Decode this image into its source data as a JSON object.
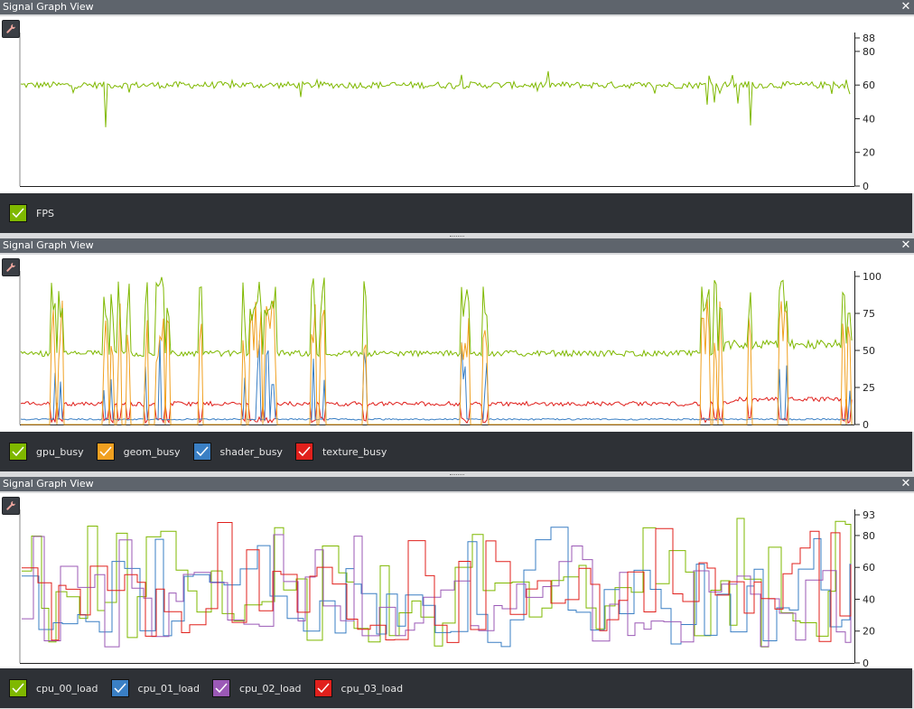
{
  "close_glyph": "✕",
  "panels": [
    {
      "title": "Signal Graph View",
      "y_ticks": [
        0,
        20,
        40,
        60,
        80,
        88
      ],
      "y_range": [
        0,
        88
      ],
      "legend": [
        {
          "label": "FPS",
          "color": "#7fb800"
        }
      ]
    },
    {
      "title": "Signal Graph View",
      "y_ticks": [
        0,
        25,
        50,
        75,
        100
      ],
      "y_range": [
        0,
        100
      ],
      "legend": [
        {
          "label": "gpu_busy",
          "color": "#7fb800"
        },
        {
          "label": "geom_busy",
          "color": "#f0a020"
        },
        {
          "label": "shader_busy",
          "color": "#3a7fc4"
        },
        {
          "label": "texture_busy",
          "color": "#e0201c"
        }
      ]
    },
    {
      "title": "Signal Graph View",
      "y_ticks": [
        0,
        20,
        40,
        60,
        80,
        93
      ],
      "y_range": [
        0,
        93
      ],
      "legend": [
        {
          "label": "cpu_00_load",
          "color": "#7fb800"
        },
        {
          "label": "cpu_01_load",
          "color": "#3a7fc4"
        },
        {
          "label": "cpu_02_load",
          "color": "#9b59b6"
        },
        {
          "label": "cpu_03_load",
          "color": "#e0201c"
        }
      ]
    }
  ]
}
